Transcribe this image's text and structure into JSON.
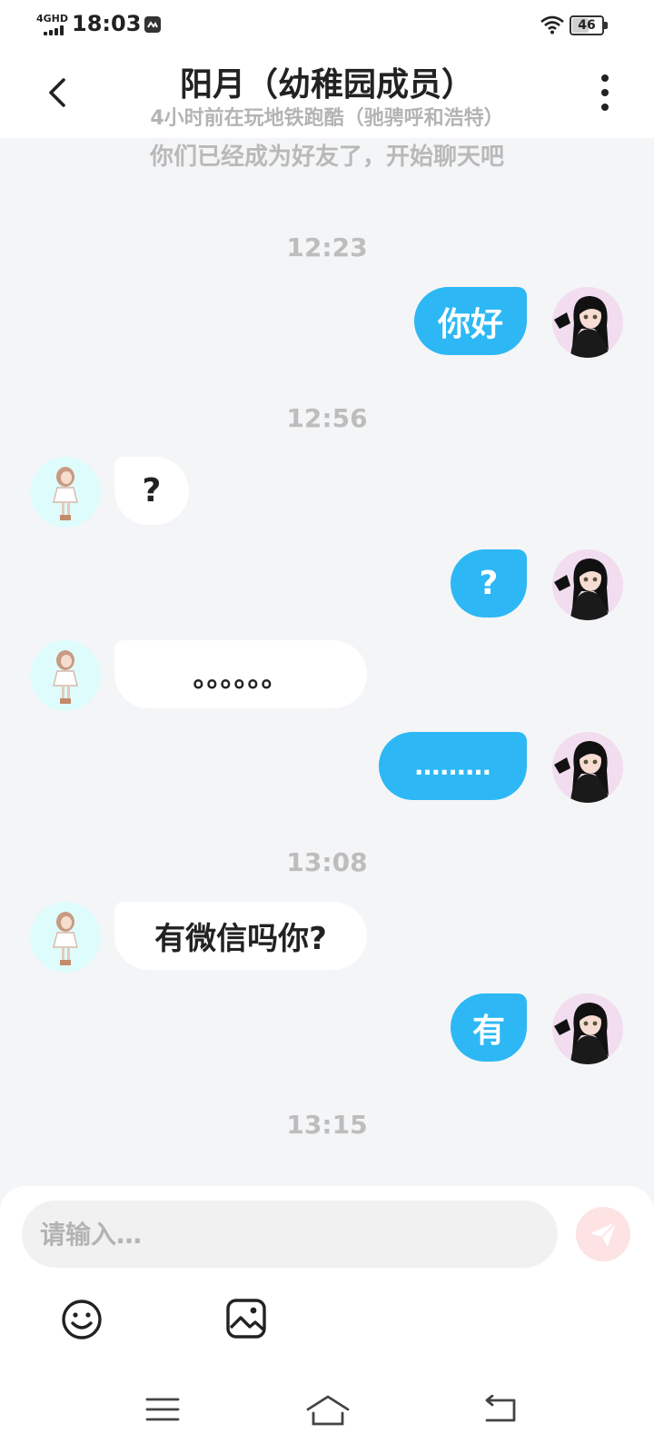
{
  "status_bar": {
    "network": "4GHD",
    "time": "18:03",
    "battery_level": "46"
  },
  "header": {
    "title": "阳月（幼稚园成员）",
    "subtitle": "4小时前在玩地铁跑酷（驰骋呼和浩特）"
  },
  "chat": {
    "system_note": "你们已经成为好友了，开始聊天吧",
    "timestamps": [
      "12:23",
      "12:56",
      "13:08",
      "13:15"
    ],
    "messages": [
      {
        "from": "me",
        "text": "你好"
      },
      {
        "from": "them",
        "text": "?"
      },
      {
        "from": "me",
        "text": "?"
      },
      {
        "from": "them",
        "text": "。。。。。。"
      },
      {
        "from": "me",
        "text": "………"
      },
      {
        "from": "them",
        "text": "有微信吗你?"
      },
      {
        "from": "me",
        "text": "有"
      }
    ]
  },
  "composer": {
    "placeholder": "请输入…"
  },
  "icons": {
    "back": "chevron-left-icon",
    "more": "more-vertical-icon",
    "send": "send-icon",
    "emoji": "emoji-icon",
    "image": "image-icon",
    "nav_menu": "menu-icon",
    "nav_home": "home-icon",
    "nav_back": "back-icon"
  },
  "colors": {
    "my_bubble": "#2db8f5",
    "their_bubble": "#ffffff",
    "background": "#f4f5f7",
    "send_button": "#fde3e4"
  }
}
